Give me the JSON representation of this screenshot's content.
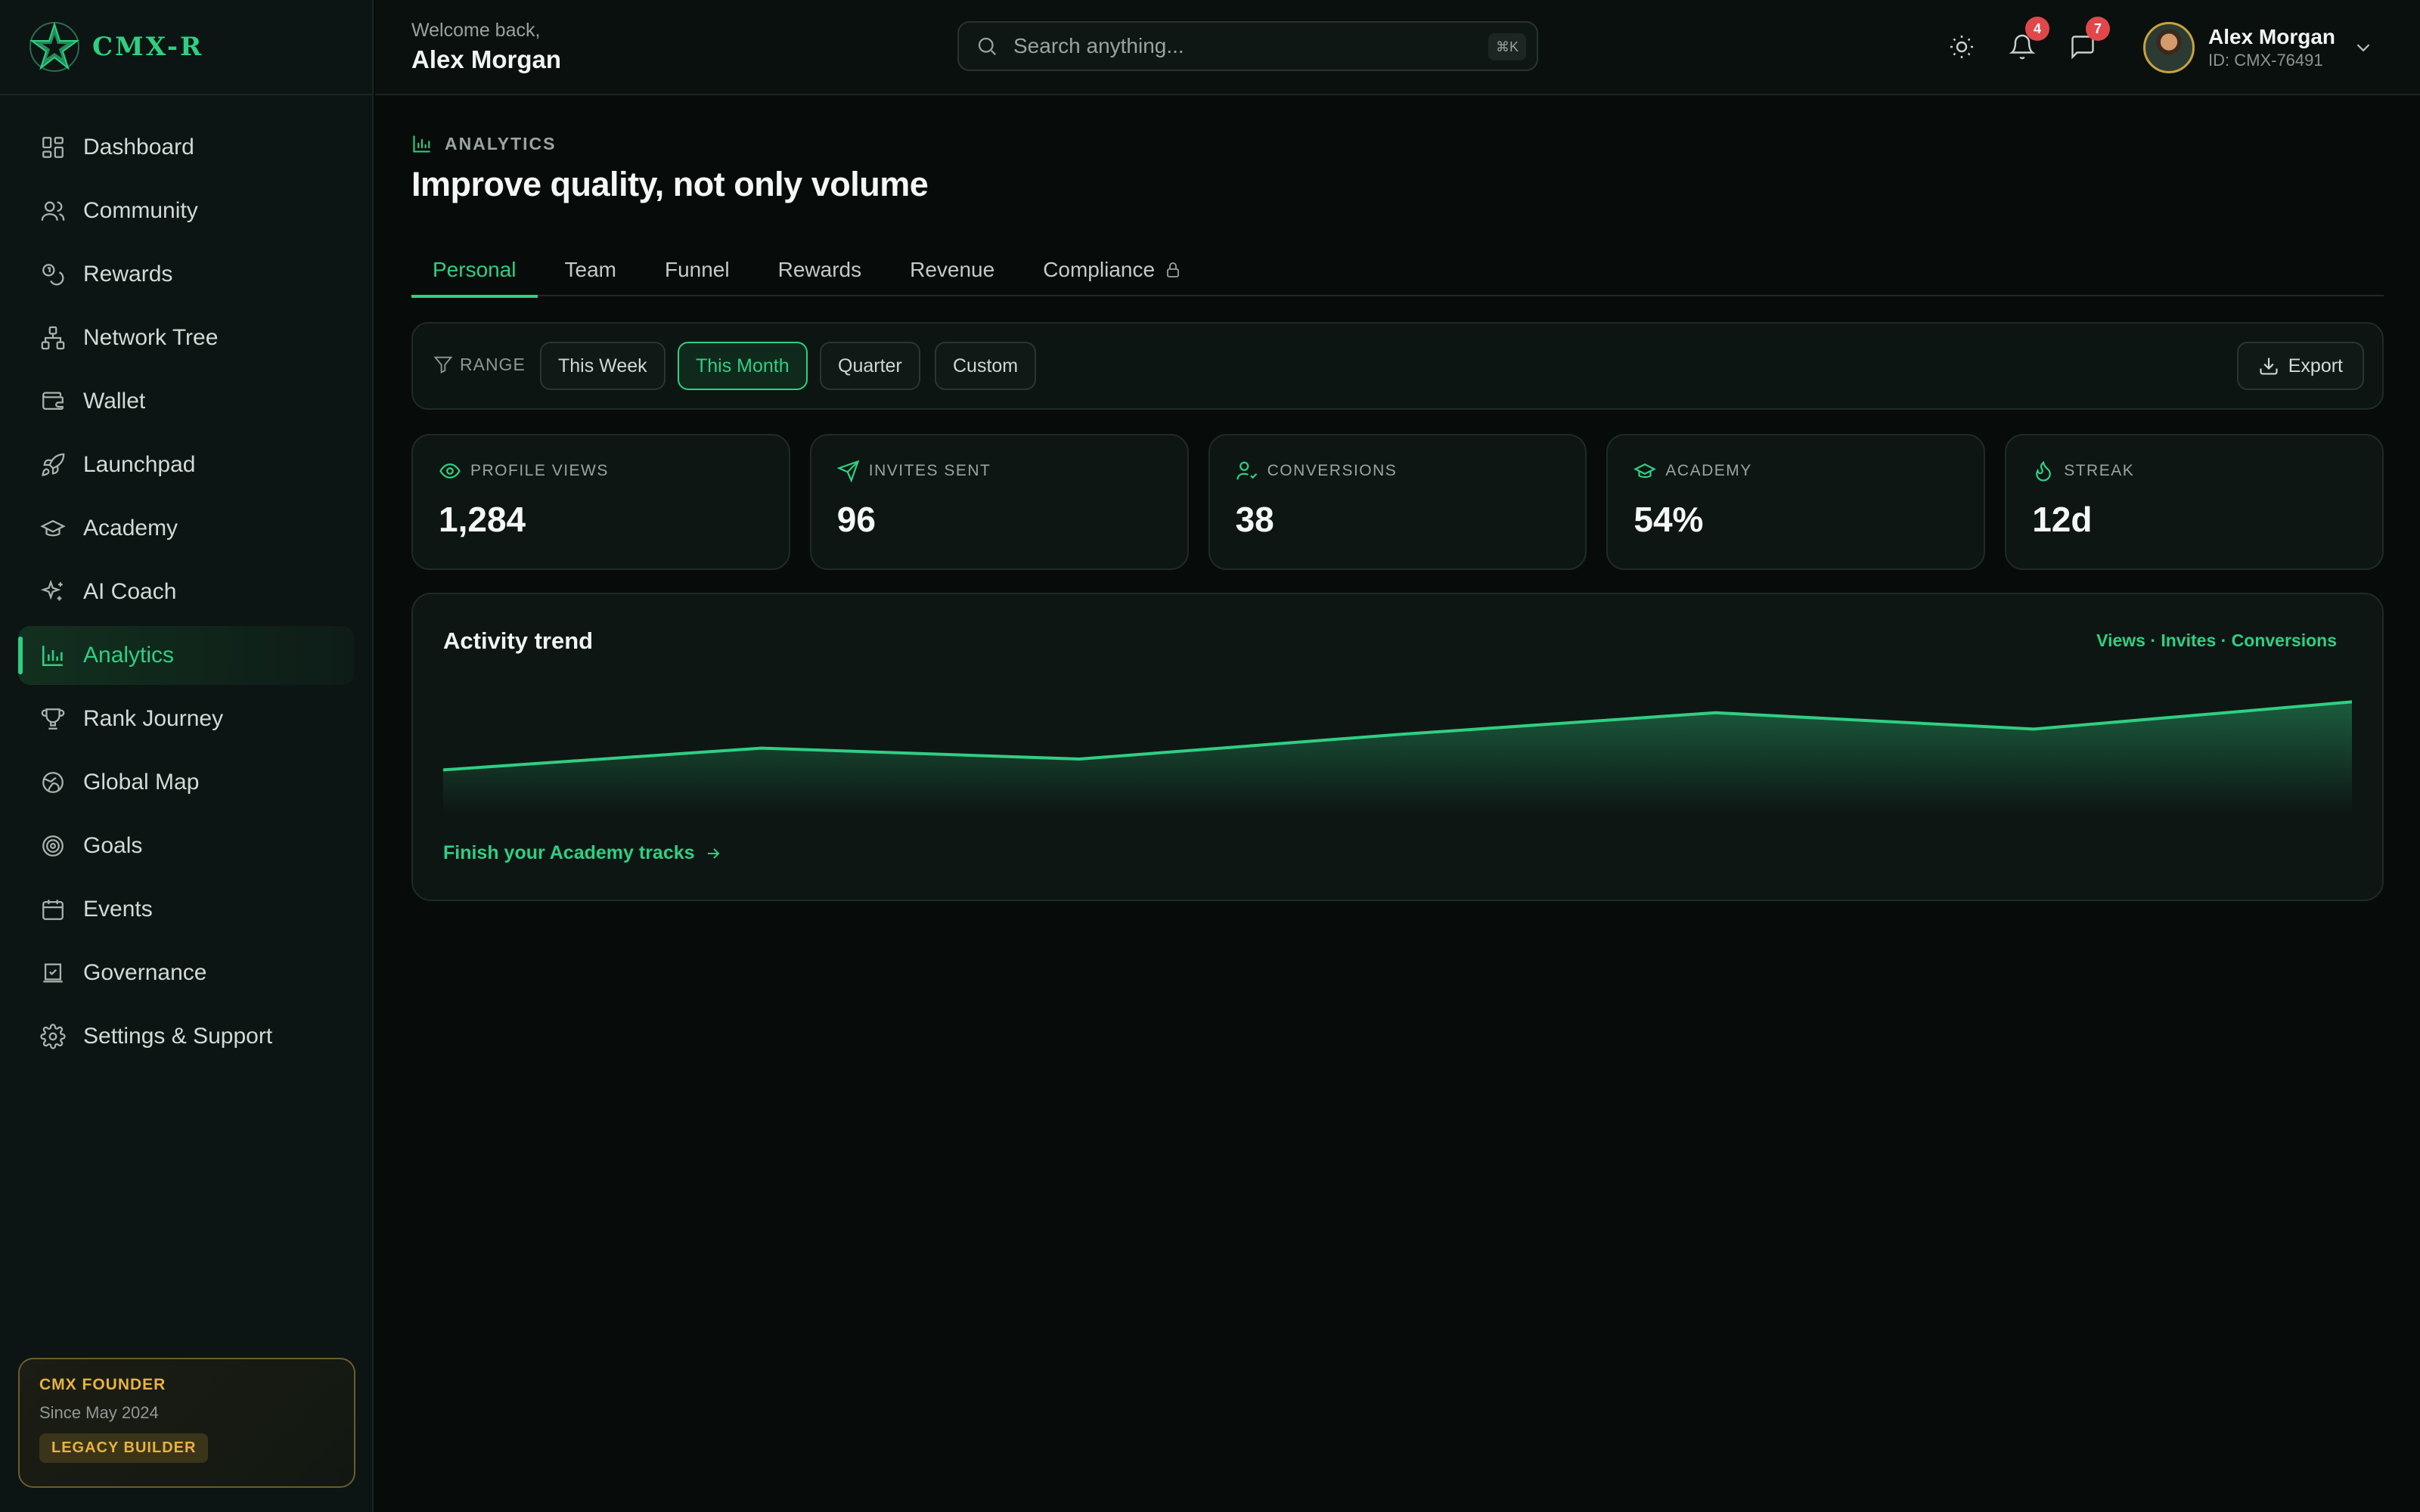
{
  "brand": {
    "name": "CMX-R"
  },
  "sidebar": {
    "items": [
      {
        "label": "Dashboard",
        "icon": "dashboard-icon",
        "active": false
      },
      {
        "label": "Community",
        "icon": "users-icon",
        "active": false
      },
      {
        "label": "Rewards",
        "icon": "coins-icon",
        "active": false
      },
      {
        "label": "Network Tree",
        "icon": "network-icon",
        "active": false
      },
      {
        "label": "Wallet",
        "icon": "wallet-icon",
        "active": false
      },
      {
        "label": "Launchpad",
        "icon": "rocket-icon",
        "active": false
      },
      {
        "label": "Academy",
        "icon": "graduation-cap-icon",
        "active": false
      },
      {
        "label": "AI Coach",
        "icon": "sparkles-icon",
        "active": false
      },
      {
        "label": "Analytics",
        "icon": "bar-chart-icon",
        "active": true
      },
      {
        "label": "Rank Journey",
        "icon": "trophy-icon",
        "active": false
      },
      {
        "label": "Global Map",
        "icon": "globe-icon",
        "active": false
      },
      {
        "label": "Goals",
        "icon": "target-icon",
        "active": false
      },
      {
        "label": "Events",
        "icon": "calendar-icon",
        "active": false
      },
      {
        "label": "Governance",
        "icon": "vote-icon",
        "active": false
      },
      {
        "label": "Settings & Support",
        "icon": "gear-icon",
        "active": false
      }
    ],
    "founder": {
      "title": "CMX FOUNDER",
      "since": "Since May 2024",
      "badge": "LEGACY BUILDER"
    }
  },
  "header": {
    "welcome": "Welcome back,",
    "name": "Alex Morgan",
    "search_placeholder": "Search anything...",
    "search_shortcut": "⌘K",
    "notifications_count": "4",
    "messages_count": "7",
    "user": {
      "name": "Alex Morgan",
      "id": "ID: CMX-76491"
    }
  },
  "page": {
    "section": "ANALYTICS",
    "title": "Improve quality, not only volume",
    "tabs": [
      {
        "label": "Personal",
        "active": true,
        "locked": false
      },
      {
        "label": "Team",
        "active": false,
        "locked": false
      },
      {
        "label": "Funnel",
        "active": false,
        "locked": false
      },
      {
        "label": "Rewards",
        "active": false,
        "locked": false
      },
      {
        "label": "Revenue",
        "active": false,
        "locked": false
      },
      {
        "label": "Compliance",
        "active": false,
        "locked": true
      }
    ],
    "range": {
      "label": "RANGE",
      "options": [
        "This Week",
        "This Month",
        "Quarter",
        "Custom"
      ],
      "selected": "This Month",
      "export_label": "Export"
    },
    "stats": [
      {
        "label": "PROFILE VIEWS",
        "value": "1,284",
        "icon": "eye-icon"
      },
      {
        "label": "INVITES SENT",
        "value": "96",
        "icon": "send-icon"
      },
      {
        "label": "CONVERSIONS",
        "value": "38",
        "icon": "user-check-icon"
      },
      {
        "label": "ACADEMY",
        "value": "54%",
        "icon": "graduation-cap-icon"
      },
      {
        "label": "STREAK",
        "value": "12d",
        "icon": "flame-icon"
      }
    ],
    "trend": {
      "title": "Activity trend",
      "legend": "Views · Invites · Conversions",
      "link": "Finish your Academy tracks"
    }
  },
  "chart_data": {
    "type": "area",
    "title": "Activity trend",
    "x": [
      0,
      1,
      2,
      3,
      4,
      5,
      6
    ],
    "values": [
      32,
      48,
      40,
      58,
      74,
      62,
      82
    ],
    "ylim": [
      0,
      100
    ],
    "grid": false,
    "color": "#2fcf82"
  },
  "colors": {
    "accent": "#2fcf82",
    "background": "#070c0a",
    "gold": "#e6b33e",
    "badge": "#e0474a"
  }
}
